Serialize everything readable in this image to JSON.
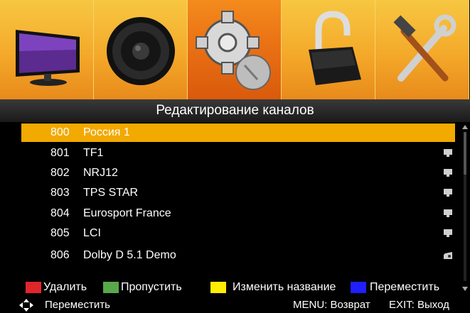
{
  "menu_tiles": [
    {
      "icon": "tv-icon"
    },
    {
      "icon": "speaker-icon"
    },
    {
      "icon": "satellite-settings-icon",
      "active": true
    },
    {
      "icon": "padlock-icon"
    },
    {
      "icon": "tools-icon"
    }
  ],
  "title": "Редактирование каналов",
  "channels": [
    {
      "number": "800",
      "name": "Россия 1",
      "icon": "",
      "selected": true
    },
    {
      "number": "801",
      "name": "TF1",
      "icon": "tv-channel-icon"
    },
    {
      "number": "802",
      "name": "NRJ12",
      "icon": "tv-channel-icon"
    },
    {
      "number": "803",
      "name": "TPS STAR",
      "icon": "tv-channel-icon"
    },
    {
      "number": "804",
      "name": "Eurosport France",
      "icon": "tv-channel-icon"
    },
    {
      "number": "805",
      "name": "LCI",
      "icon": "tv-channel-icon"
    },
    {
      "number": "806",
      "name": "Dolby D 5.1 Demo",
      "icon": "radio-channel-icon"
    }
  ],
  "legend": {
    "red": {
      "label": "Удалить",
      "color": "#e0262a"
    },
    "green": {
      "label": "Пропустить",
      "color": "#5aa64a"
    },
    "yellow": {
      "label": "Изменить название",
      "color": "#ffee00"
    },
    "blue": {
      "label": "Переместить",
      "color": "#1f1fff"
    }
  },
  "footer": {
    "move_label": "Переместить",
    "menu_label": "MENU: Возврат",
    "exit_label": "EXIT: Выход"
  },
  "colors": {
    "selected_row": "#f2a900",
    "active_tile": "#ea7114"
  }
}
